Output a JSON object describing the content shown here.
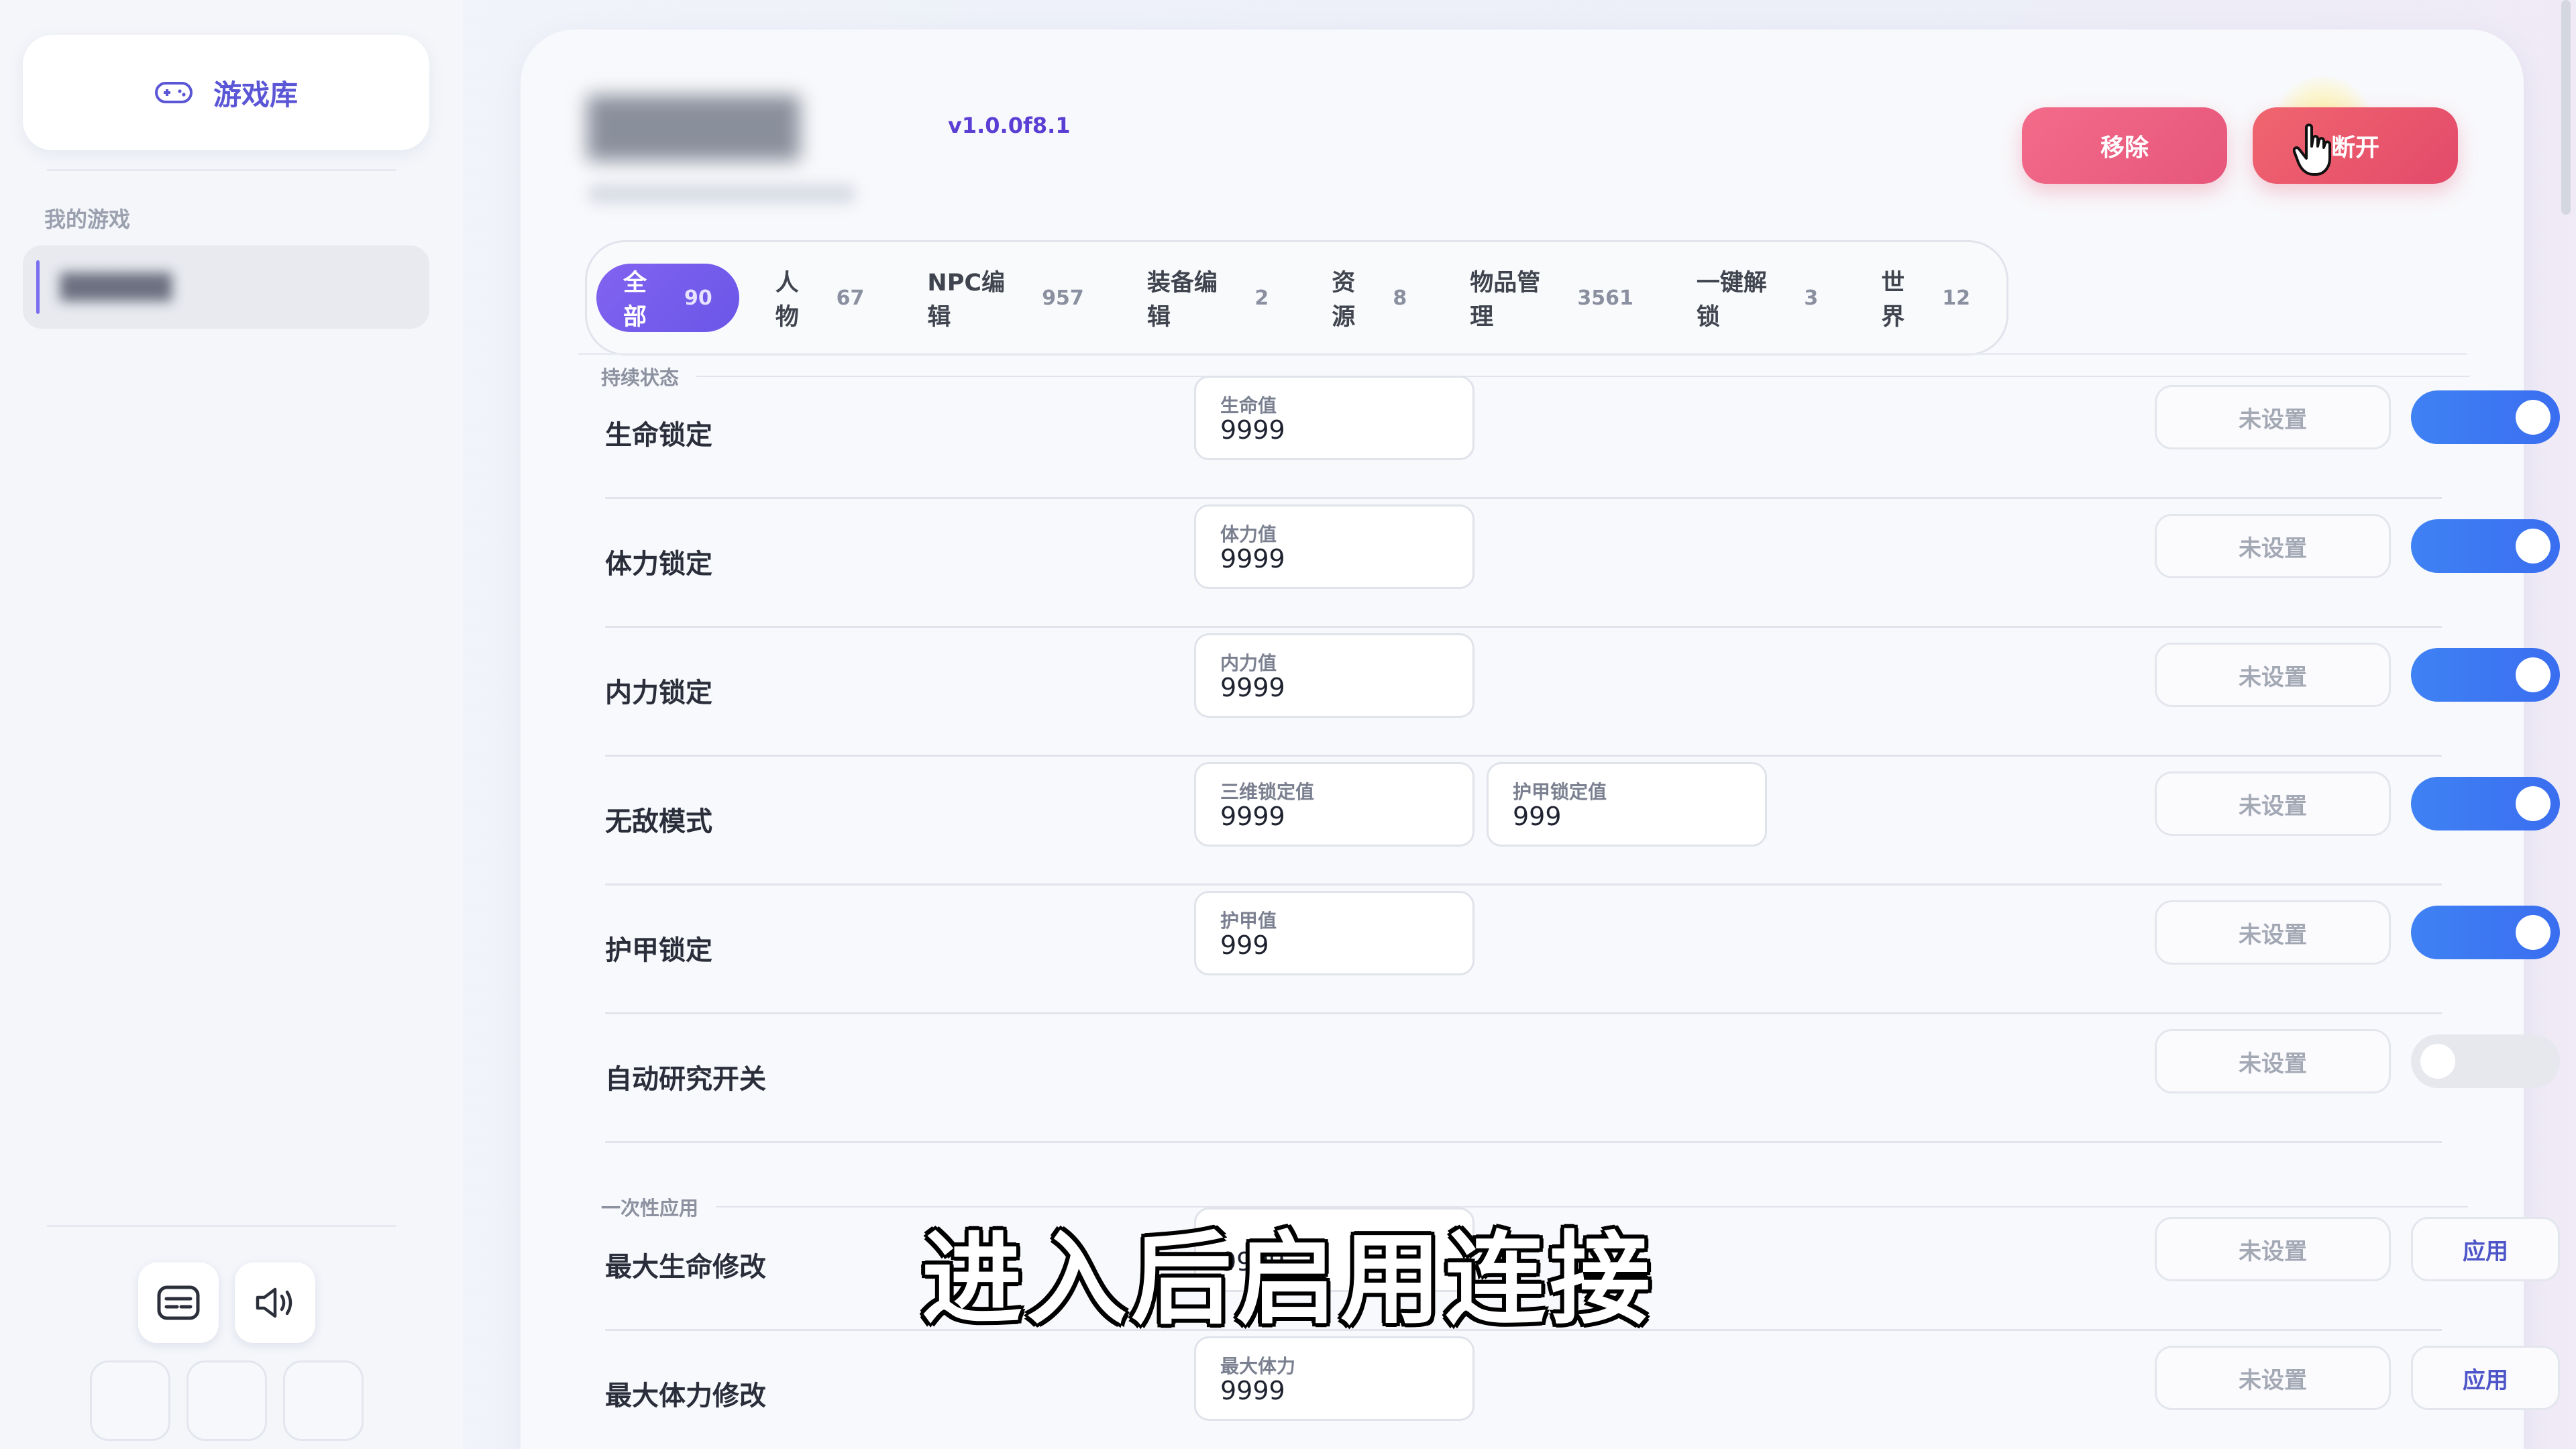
{
  "sidebar": {
    "library_label": "游戏库",
    "my_games_label": "我的游戏",
    "game_item_label": "██████"
  },
  "header": {
    "game_title": "█████",
    "version": "v1.0.0f8.1",
    "remove_label": "移除",
    "disconnect_label": "断开"
  },
  "tabs": [
    {
      "label": "全部",
      "count": "90",
      "active": true
    },
    {
      "label": "人物",
      "count": "67"
    },
    {
      "label": "NPC编辑",
      "count": "957"
    },
    {
      "label": "装备编辑",
      "count": "2"
    },
    {
      "label": "资源",
      "count": "8"
    },
    {
      "label": "物品管理",
      "count": "3561"
    },
    {
      "label": "一键解锁",
      "count": "3"
    },
    {
      "label": "世界",
      "count": "12"
    }
  ],
  "sections": {
    "persistent": "持续状态",
    "one_time": "一次性应用"
  },
  "rows": [
    {
      "label": "生命锁定",
      "fields": [
        {
          "label": "生命值",
          "value": "9999"
        }
      ],
      "unset": "未设置",
      "toggle": "on"
    },
    {
      "label": "体力锁定",
      "fields": [
        {
          "label": "体力值",
          "value": "9999"
        }
      ],
      "unset": "未设置",
      "toggle": "on"
    },
    {
      "label": "内力锁定",
      "fields": [
        {
          "label": "内力值",
          "value": "9999"
        }
      ],
      "unset": "未设置",
      "toggle": "on"
    },
    {
      "label": "无敌模式",
      "fields": [
        {
          "label": "三维锁定值",
          "value": "9999"
        },
        {
          "label": "护甲锁定值",
          "value": "999"
        }
      ],
      "unset": "未设置",
      "toggle": "on"
    },
    {
      "label": "护甲锁定",
      "fields": [
        {
          "label": "护甲值",
          "value": "999"
        }
      ],
      "unset": "未设置",
      "toggle": "on"
    },
    {
      "label": "自动研究开关",
      "fields": [],
      "unset": "未设置",
      "toggle": "off"
    },
    {
      "label": "最大生命修改",
      "fields": [
        {
          "label": "",
          "value": "9999"
        }
      ],
      "unset": "未设置",
      "apply": "应用"
    },
    {
      "label": "最大体力修改",
      "fields": [
        {
          "label": "最大体力",
          "value": "9999"
        }
      ],
      "unset": "未设置",
      "apply": "应用"
    }
  ],
  "subtitle": "进入后启用连接",
  "colors": {
    "accent": "#6a56e8",
    "toggle_on": "#3f82f4",
    "danger": "#e6567b"
  }
}
